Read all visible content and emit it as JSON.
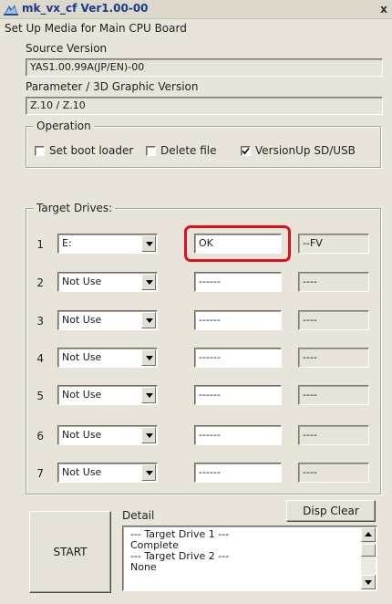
{
  "window": {
    "title": "mk_vx_cf Ver1.00-00",
    "close_glyph": "x",
    "icon": "app-icon"
  },
  "header": {
    "subtitle": "Set Up Media for Main CPU Board"
  },
  "source_version": {
    "label": "Source Version",
    "value": "YAS1.00.99A(JP/EN)-00"
  },
  "parameter_version": {
    "label": "Parameter / 3D Graphic Version",
    "value": "Z.10 / Z.10"
  },
  "operation": {
    "title": "Operation",
    "options": [
      {
        "label": "Set boot loader",
        "checked": false
      },
      {
        "label": "Delete file",
        "checked": false
      },
      {
        "label": "VersionUp SD/USB",
        "checked": true
      }
    ]
  },
  "target_drives": {
    "title": "Target Drives:",
    "rows": [
      {
        "num": "1",
        "drive": "E:",
        "status": "OK",
        "fv": "--FV"
      },
      {
        "num": "2",
        "drive": "Not Use",
        "status": "------",
        "fv": "----"
      },
      {
        "num": "3",
        "drive": "Not Use",
        "status": "------",
        "fv": "----"
      },
      {
        "num": "4",
        "drive": "Not Use",
        "status": "------",
        "fv": "----"
      },
      {
        "num": "5",
        "drive": "Not Use",
        "status": "------",
        "fv": "----"
      },
      {
        "num": "6",
        "drive": "Not Use",
        "status": "------",
        "fv": "----"
      },
      {
        "num": "7",
        "drive": "Not Use",
        "status": "------",
        "fv": "----"
      }
    ]
  },
  "bottom": {
    "start_label": "START",
    "detail_label": "Detail",
    "disp_clear_label": "Disp Clear",
    "detail_lines": [
      "--- Target Drive 1 ---",
      "Complete",
      "--- Target Drive 2 ---",
      "None"
    ]
  },
  "colors": {
    "highlight": "#e0101a",
    "title_text": "#1a3a8c",
    "window_bg": "#e8e4da"
  }
}
